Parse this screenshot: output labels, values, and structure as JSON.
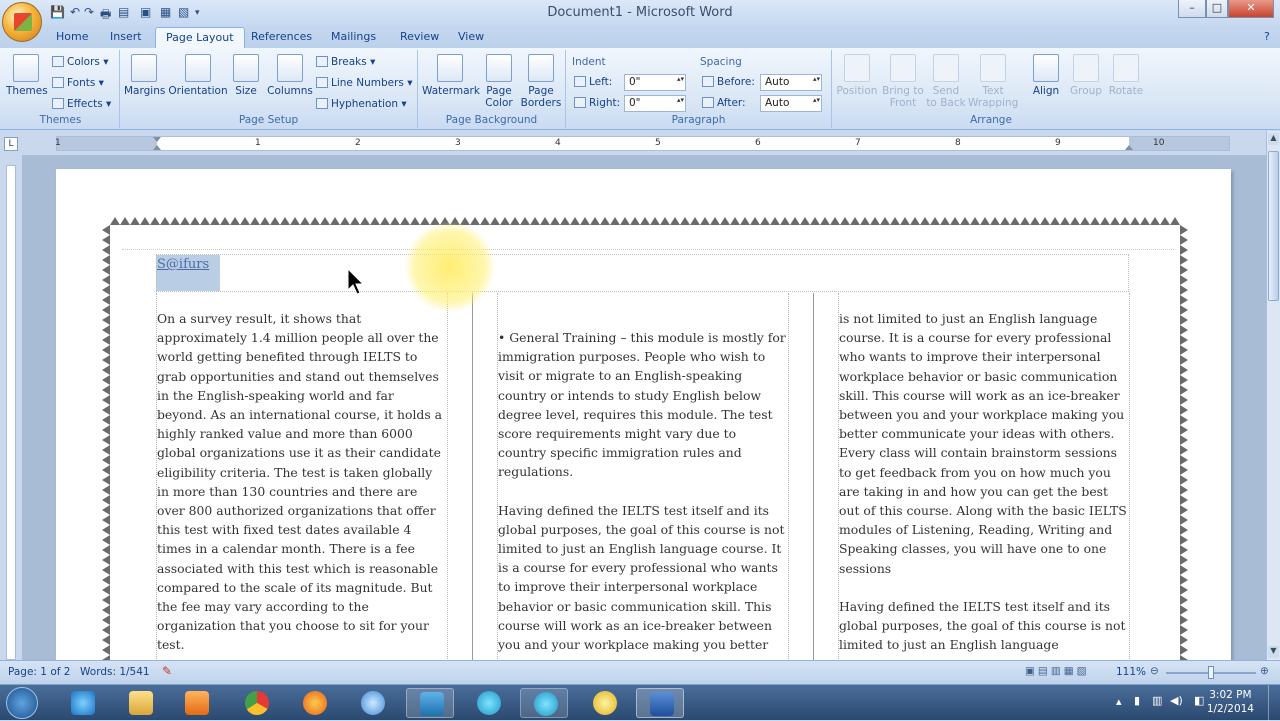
{
  "window": {
    "title": "Document1 - Microsoft Word"
  },
  "tabs": [
    "Home",
    "Insert",
    "Page Layout",
    "References",
    "Mailings",
    "Review",
    "View"
  ],
  "active_tab": "Page Layout",
  "ribbon": {
    "themes": {
      "label": "Themes",
      "group": "Themes",
      "colors": "Colors",
      "fonts": "Fonts",
      "effects": "Effects"
    },
    "page_setup": {
      "group": "Page Setup",
      "margins": "Margins",
      "orientation": "Orientation",
      "size": "Size",
      "columns": "Columns",
      "breaks": "Breaks",
      "line_numbers": "Line Numbers",
      "hyphenation": "Hyphenation"
    },
    "page_background": {
      "group": "Page Background",
      "watermark": "Watermark",
      "page_color": "Page Color",
      "page_borders": "Page Borders"
    },
    "paragraph": {
      "group": "Paragraph",
      "indent": "Indent",
      "left_label": "Left:",
      "left_value": "0\"",
      "right_label": "Right:",
      "right_value": "0\"",
      "spacing": "Spacing",
      "before_label": "Before:",
      "before_value": "Auto",
      "after_label": "After:",
      "after_value": "Auto"
    },
    "arrange": {
      "group": "Arrange",
      "position": "Position",
      "bring_to_front": "Bring to Front",
      "send_to_back": "Send to Back",
      "text_wrapping": "Text Wrapping",
      "align": "Align",
      "group_btn": "Group",
      "rotate": "Rotate"
    }
  },
  "ruler": {
    "numbers": [
      "1",
      "1",
      "2",
      "3",
      "4",
      "5",
      "6",
      "7",
      "8",
      "9",
      "10"
    ]
  },
  "document": {
    "header_text": "S@ifurs",
    "col1": "On a survey result, it shows that approximately 1.4 million people all over the world getting benefited through IELTS to grab opportunities and stand out themselves in the English-speaking world and far beyond. As an international course, it holds a highly ranked value and more than 6000 global organizations use it as their candidate eligibility criteria. The test is taken globally in more than 130 countries and there are over 800 authorized organizations that offer this test with fixed test dates available 4 times in a calendar month. There is a fee associated with this test which is reasonable compared to the scale of its magnitude. But the fee may vary according to the organization that you choose to sit for your test.",
    "col2_p1": "• General Training – this module is mostly for immigration purposes. People who wish to visit or migrate to an English-speaking country or intends to study English below degree level, requires this module. The test score requirements might vary due to country specific immigration rules and regulations.",
    "col2_p2": "Having defined the IELTS test itself and its global purposes, the goal of this course is not limited to just an English language course. It is a course for every professional who wants to improve their interpersonal workplace behavior or basic communication skill. This course will work as an ice-breaker between you and your workplace making you better",
    "col3_p1": "is not limited to just an English language course. It is a course for every professional who wants to improve their interpersonal workplace behavior or basic communication skill. This course will work as an ice-breaker between you and your workplace making you better communicate your ideas with others. Every class will contain brainstorm sessions to get feedback from you on how much you are taking in and how you can get the best out of this course. Along with the basic IELTS modules of Listening, Reading, Writing and Speaking classes, you will have one to one sessions",
    "col3_p2": "Having defined the IELTS test itself and its global purposes, the goal of this course is not limited to just an English language"
  },
  "status": {
    "page": "Page: 1 of 2",
    "words": "Words: 1/541",
    "zoom": "111%"
  },
  "taskbar": {
    "time": "3:02 PM",
    "date": "1/2/2014"
  }
}
